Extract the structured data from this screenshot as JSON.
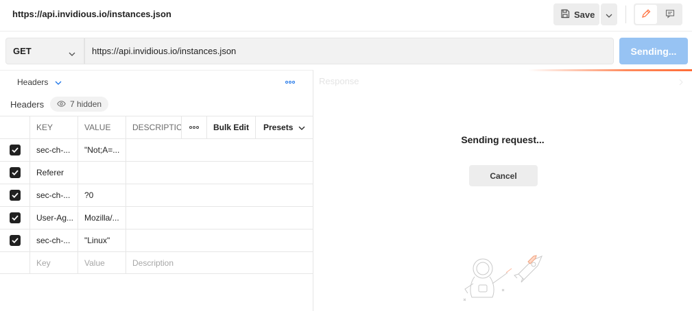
{
  "header": {
    "title": "https://api.invidious.io/instances.json",
    "save_label": "Save"
  },
  "request": {
    "method": "GET",
    "url": "https://api.invidious.io/instances.json",
    "send_label": "Sending..."
  },
  "left_pane": {
    "tab_label": "Headers",
    "section_label": "Headers",
    "hidden_badge": "7 hidden",
    "columns": {
      "key": "KEY",
      "value": "VALUE",
      "description": "DESCRIPTIO",
      "bulk_edit": "Bulk Edit",
      "presets": "Presets"
    },
    "rows": [
      {
        "key": "sec-ch-...",
        "value": "\"Not;A=...",
        "checked": true
      },
      {
        "key": "Referer",
        "value": "",
        "checked": true
      },
      {
        "key": "sec-ch-...",
        "value": "?0",
        "checked": true
      },
      {
        "key": "User-Ag...",
        "value": "Mozilla/...",
        "checked": true
      },
      {
        "key": "sec-ch-...",
        "value": "\"Linux\"",
        "checked": true
      }
    ],
    "new_row": {
      "key_placeholder": "Key",
      "value_placeholder": "Value",
      "description_placeholder": "Description"
    }
  },
  "response": {
    "title": "Response",
    "status_text": "Sending request...",
    "cancel_label": "Cancel"
  },
  "colors": {
    "send_button": "#97c3f3",
    "progress_accent": "#ff6c37",
    "checkbox": "#212121"
  },
  "icons": [
    "save-icon",
    "chevron-down-icon",
    "pencil-icon",
    "comment-icon",
    "more-horizontal-icon",
    "eye-icon",
    "check-icon",
    "chevron-right-icon",
    "astronaut-illustration"
  ]
}
